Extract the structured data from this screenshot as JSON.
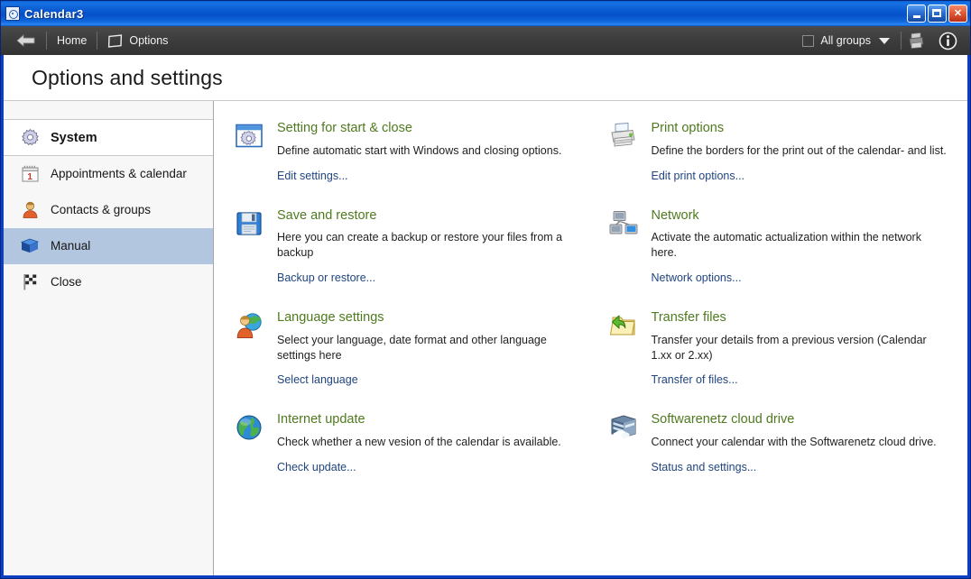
{
  "window": {
    "title": "Calendar3",
    "icon": "app-icon",
    "buttons": {
      "minimize": "minimize",
      "maximize": "maximize",
      "close": "close"
    }
  },
  "toolbar": {
    "back_icon": "back-arrow-icon",
    "home_label": "Home",
    "options_label": "Options",
    "options_icon": "page-icon",
    "all_groups_label": "All groups",
    "all_groups_checked": false,
    "printer_icon": "printer-icon",
    "info_icon": "info-icon"
  },
  "page": {
    "title": "Options and settings"
  },
  "sidebar": {
    "items": [
      {
        "label": "System",
        "icon": "gear-icon",
        "selected": false,
        "header": true
      },
      {
        "label": "Appointments & calendar",
        "icon": "calendar-icon",
        "selected": false,
        "header": false
      },
      {
        "label": "Contacts & groups",
        "icon": "user-icon",
        "selected": false,
        "header": false
      },
      {
        "label": "Manual",
        "icon": "book-icon",
        "selected": true,
        "header": false
      },
      {
        "label": "Close",
        "icon": "flag-icon",
        "selected": false,
        "header": false
      }
    ]
  },
  "cards": [
    {
      "icon": "settings-window-icon",
      "title": "Setting for start & close",
      "desc": "Define automatic start with Windows and closing options.",
      "link": "Edit settings..."
    },
    {
      "icon": "printer-icon",
      "title": "Print options",
      "desc": "Define the borders for the print out of the calendar- and list.",
      "link": "Edit print options..."
    },
    {
      "icon": "floppy-disk-icon",
      "title": "Save and restore",
      "desc": "Here you can create a backup or restore your files from a backup",
      "link": "Backup or restore..."
    },
    {
      "icon": "network-icon",
      "title": "Network",
      "desc": "Activate the automatic actualization within the network here.",
      "link": "Network options..."
    },
    {
      "icon": "language-globe-user-icon",
      "title": "Language settings",
      "desc": "Select your language, date format and other language settings here",
      "link": "Select language"
    },
    {
      "icon": "transfer-folder-icon",
      "title": "Transfer files",
      "desc": "Transfer your details from a previous version (Calendar 1.xx or 2.xx)",
      "link": "Transfer of files..."
    },
    {
      "icon": "globe-icon",
      "title": "Internet update",
      "desc": "Check whether a new vesion of the calendar is available.",
      "link": "Check update..."
    },
    {
      "icon": "cloud-drive-icon",
      "title": "Softwarenetz cloud drive",
      "desc": "Connect your calendar with the Softwarenetz cloud drive.",
      "link": "Status and settings..."
    }
  ],
  "colors": {
    "titlebar_blue": "#0a5ad2",
    "toolbar_dark": "#3c3c3c",
    "card_title_green": "#4f7a1f",
    "link_blue": "#21457f",
    "selected_sidebar": "#b3c6e0",
    "frame_blue": "#0c3fc4"
  }
}
